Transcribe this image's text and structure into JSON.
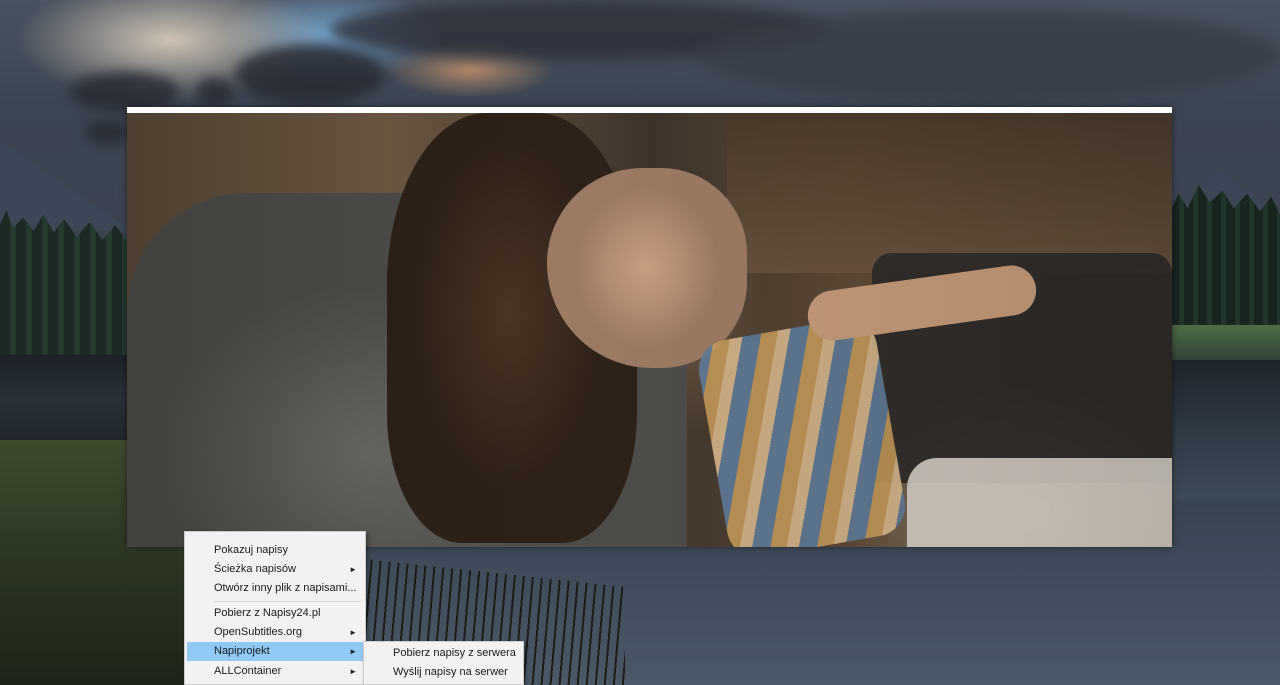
{
  "desktop": {
    "wallpaper": "lake-mountain-dusk"
  },
  "player": {
    "window": "video-player",
    "frame_description_icon": "video-frame"
  },
  "context_menu": {
    "items": [
      {
        "label": "Pokazuj napisy",
        "has_submenu": false
      },
      {
        "label": "Ścieżka napisów",
        "has_submenu": true
      },
      {
        "label": "Otwórz inny plik z napisami...",
        "has_submenu": false
      },
      {
        "label": "Pobierz z Napisy24.pl",
        "has_submenu": false
      },
      {
        "label": "OpenSubtitles.org",
        "has_submenu": true
      },
      {
        "label": "Napiprojekt",
        "has_submenu": true,
        "active": true
      },
      {
        "label": "ALLContainer",
        "has_submenu": true
      }
    ],
    "submenu_arrow": "►"
  },
  "submenu": {
    "parent": "Napiprojekt",
    "items": [
      {
        "label": "Pobierz napisy z serwera"
      },
      {
        "label": "Wyślij napisy na serwer"
      }
    ]
  },
  "colors": {
    "menu_background": "#f2f2f2",
    "menu_highlight": "#91c9f7",
    "menu_text": "#1a1a1a"
  }
}
